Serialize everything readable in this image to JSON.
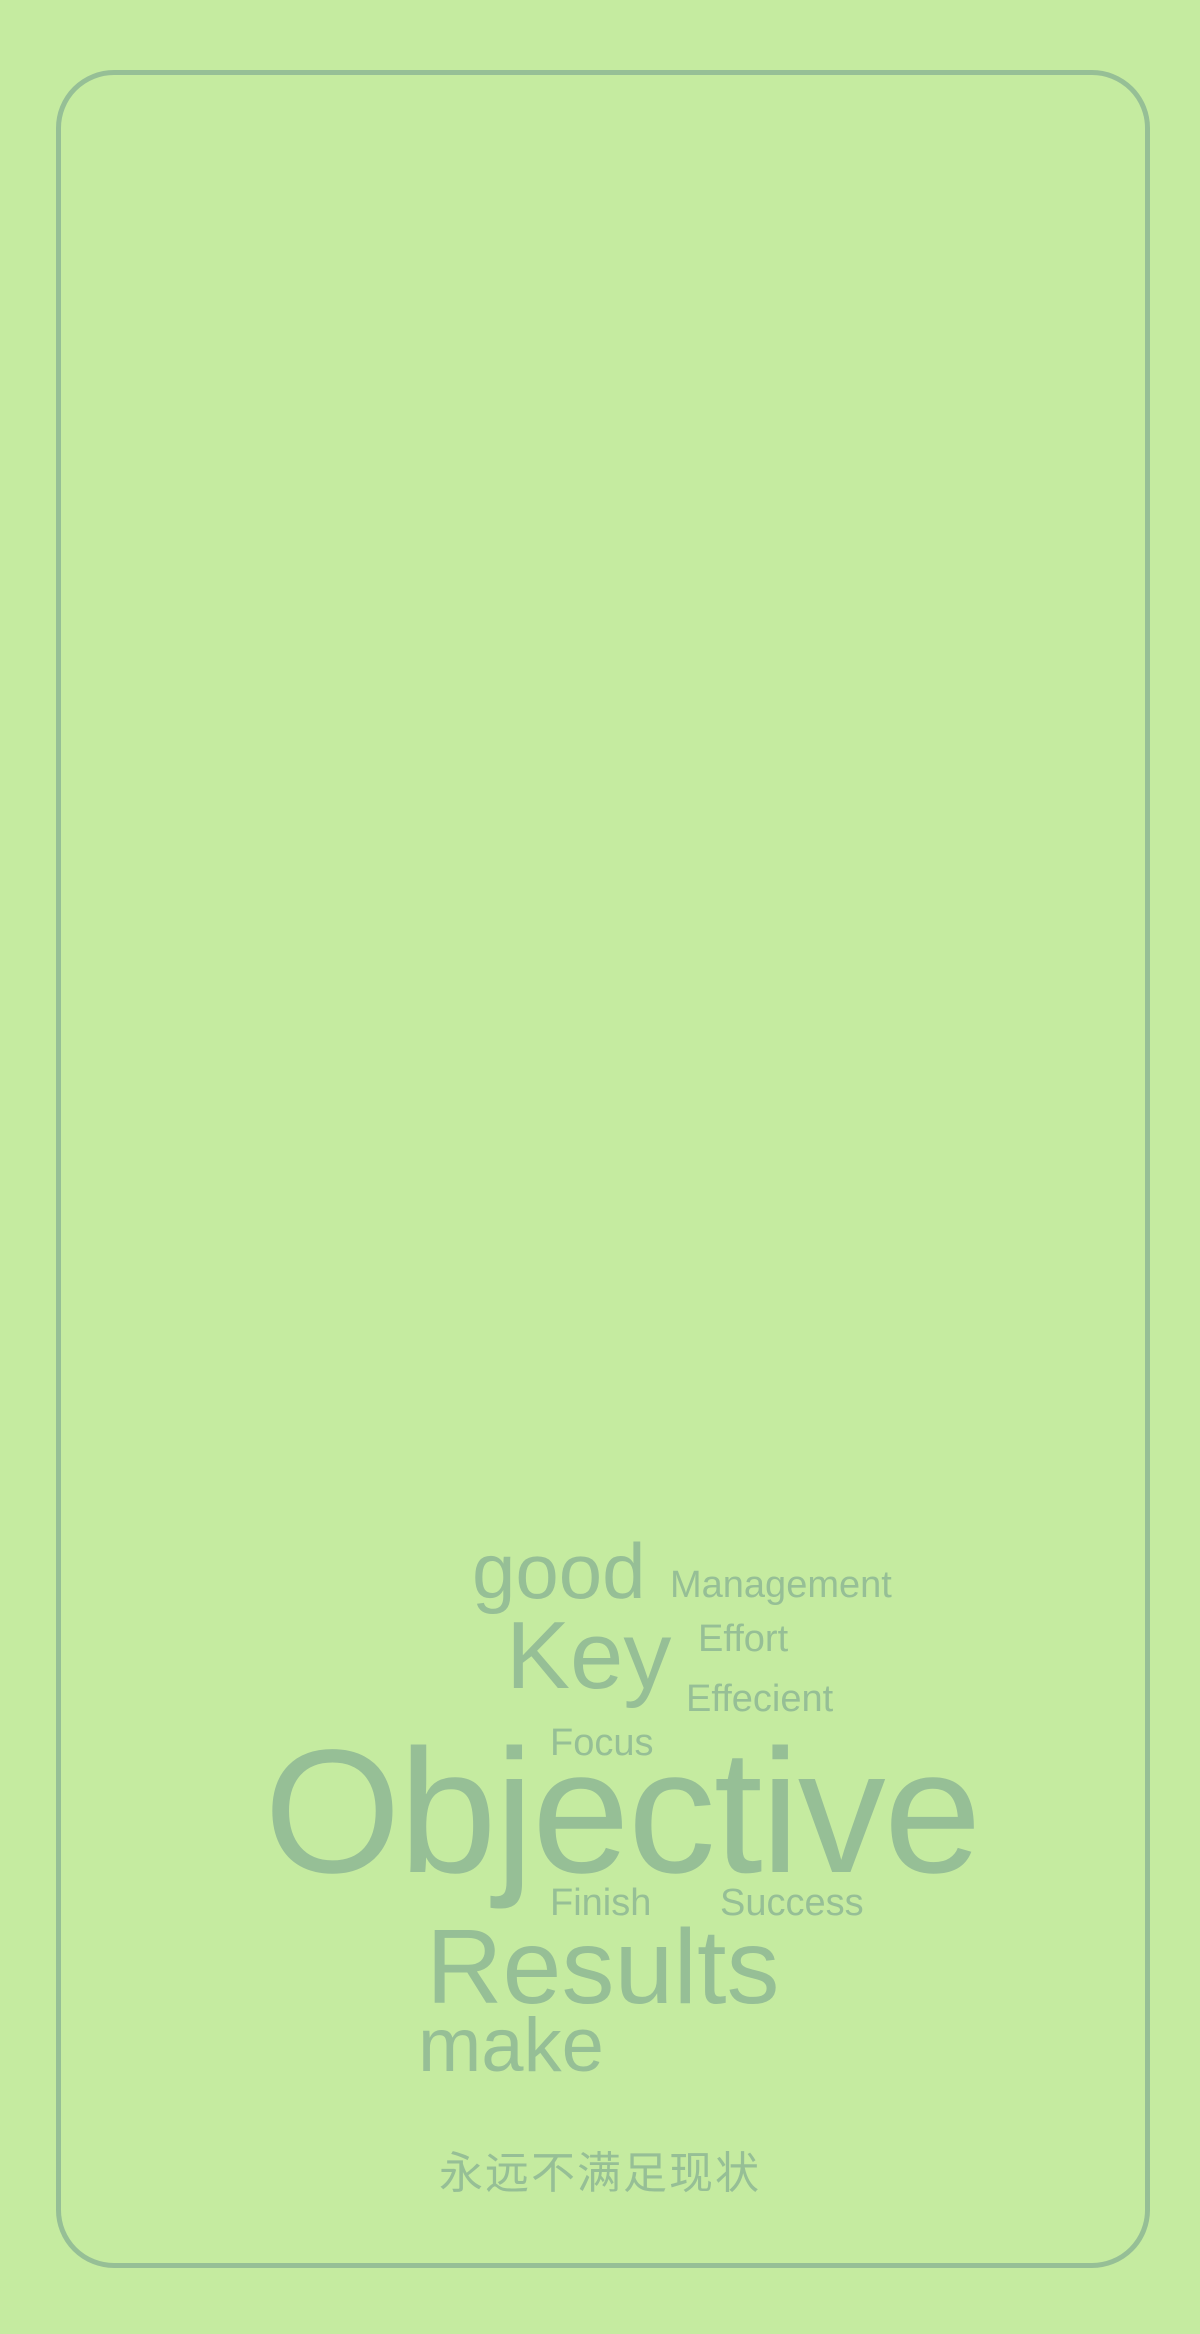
{
  "colors": {
    "background": "#c5eba0",
    "accent": "#96bf96"
  },
  "word_cloud": {
    "words": {
      "good": "good",
      "management": "Management",
      "key": "Key",
      "effort": "Effort",
      "effecient": "Effecient",
      "focus": "Focus",
      "objective": "Objective",
      "finish": "Finish",
      "success": "Success",
      "results": "Results",
      "make": "make"
    }
  },
  "slogan": "永远不满足现状"
}
